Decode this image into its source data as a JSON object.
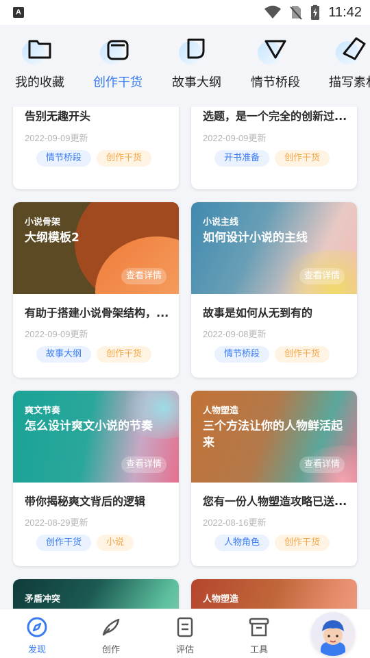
{
  "status_bar": {
    "time": "11:42",
    "notification_icon": "A"
  },
  "top_nav": {
    "items": [
      {
        "label": "我的收藏",
        "icon": "folder-icon",
        "active": false
      },
      {
        "label": "创作干货",
        "icon": "box-icon",
        "active": true
      },
      {
        "label": "故事大纲",
        "icon": "note-icon",
        "active": false
      },
      {
        "label": "情节桥段",
        "icon": "triangle-icon",
        "active": false
      },
      {
        "label": "描写素材",
        "icon": "tag-icon",
        "active": false
      }
    ]
  },
  "cards": [
    {
      "title": "告别无趣开头",
      "date": "2022-09-09更新",
      "tags": [
        "情节桥段",
        "创作干货"
      ]
    },
    {
      "title": "选题，是一个完全的创新过...",
      "date": "2022-09-09更新",
      "tags": [
        "开书准备",
        "创作干货"
      ]
    },
    {
      "category": "小说骨架",
      "cover_title": "大纲模板2",
      "detail": "查看详情",
      "title": "有助于搭建小说骨架结构，...",
      "date": "2022-09-09更新",
      "tags": [
        "故事大纲",
        "创作干货"
      ]
    },
    {
      "category": "小说主线",
      "cover_title": "如何设计小说的主线",
      "detail": "查看详情",
      "title": "故事是如何从无到有的",
      "date": "2022-09-08更新",
      "tags": [
        "情节桥段",
        "创作干货"
      ]
    },
    {
      "category": "爽文节奏",
      "cover_title": "怎么设计爽文小说的节奏",
      "detail": "查看详情",
      "title": "带你揭秘爽文背后的逻辑",
      "date": "2022-08-29更新",
      "tags": [
        "创作干货",
        "小说"
      ]
    },
    {
      "category": "人物塑造",
      "cover_title": "三个方法让你的人物鲜活起来",
      "detail": "查看详情",
      "title": "您有一份人物塑造攻略已送...",
      "date": "2022-08-16更新",
      "tags": [
        "人物角色",
        "创作干货"
      ]
    },
    {
      "category": "矛盾冲突"
    },
    {
      "category": "人物塑造"
    }
  ],
  "bottom_tabs": [
    {
      "label": "发现",
      "icon": "compass-icon",
      "active": true
    },
    {
      "label": "创作",
      "icon": "quill-icon",
      "active": false
    },
    {
      "label": "评估",
      "icon": "document-icon",
      "active": false
    },
    {
      "label": "工具",
      "icon": "archive-box-icon",
      "active": false
    }
  ],
  "colors": {
    "accent": "#3a7cf0",
    "tag_blue_bg": "#eaf2ff",
    "tag_orange_bg": "#fff4e3",
    "tag_orange_text": "#f3a64a"
  }
}
